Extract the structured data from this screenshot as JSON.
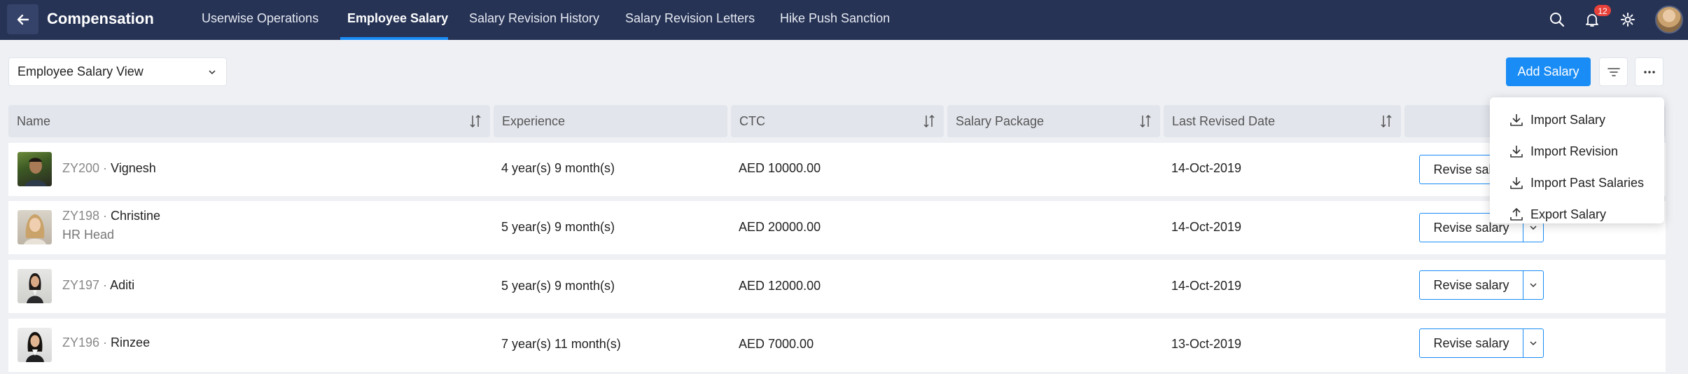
{
  "app": {
    "title": "Compensation"
  },
  "nav": {
    "tabs": [
      {
        "label": "Userwise Operations"
      },
      {
        "label": "Employee Salary"
      },
      {
        "label": "Salary Revision History"
      },
      {
        "label": "Salary Revision Letters"
      },
      {
        "label": "Hike Push Sanction"
      }
    ],
    "active_tab": "Employee Salary",
    "notification_count": "12"
  },
  "toolbar": {
    "view_select": "Employee Salary View",
    "add_button": "Add Salary"
  },
  "table": {
    "columns": [
      "Name",
      "Experience",
      "CTC",
      "Salary Package",
      "Last Revised Date"
    ],
    "rows": [
      {
        "id": "ZY200",
        "sep": " · ",
        "name": "Vignesh",
        "subtitle": "",
        "experience": "4 year(s) 9 month(s)",
        "ctc": "AED 10000.00",
        "package": "",
        "last_revised": "14-Oct-2019",
        "action": "Revise salary"
      },
      {
        "id": "ZY198",
        "sep": " · ",
        "name": "Christine",
        "subtitle": "HR Head",
        "experience": "5 year(s) 9 month(s)",
        "ctc": "AED 20000.00",
        "package": "",
        "last_revised": "14-Oct-2019",
        "action": "Revise salary"
      },
      {
        "id": "ZY197",
        "sep": " · ",
        "name": "Aditi",
        "subtitle": "",
        "experience": "5 year(s) 9 month(s)",
        "ctc": "AED 12000.00",
        "package": "",
        "last_revised": "14-Oct-2019",
        "action": "Revise salary"
      },
      {
        "id": "ZY196",
        "sep": " · ",
        "name": "Rinzee",
        "subtitle": "",
        "experience": "7 year(s) 11 month(s)",
        "ctc": "AED 7000.00",
        "package": "",
        "last_revised": "13-Oct-2019",
        "action": "Revise salary"
      }
    ]
  },
  "more_menu": {
    "items": [
      {
        "label": "Import Salary",
        "icon": "download-icon"
      },
      {
        "label": "Import Revision",
        "icon": "download-icon"
      },
      {
        "label": "Import Past Salaries",
        "icon": "download-icon"
      },
      {
        "label": "Export Salary",
        "icon": "upload-icon"
      }
    ]
  },
  "colors": {
    "topbar": "#263355",
    "accent": "#1a8cf5",
    "badge": "#e8413a"
  }
}
